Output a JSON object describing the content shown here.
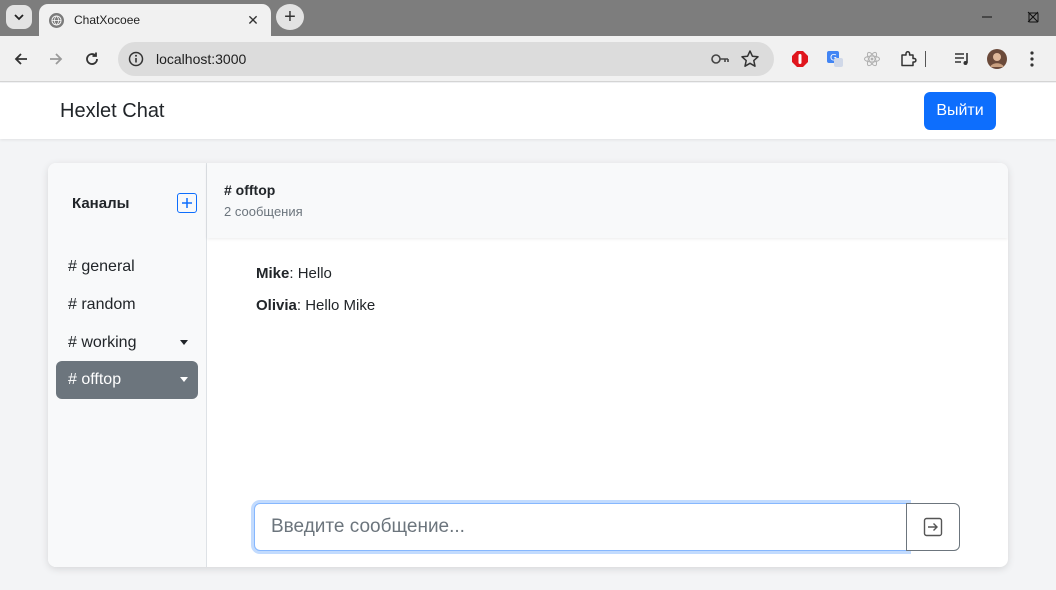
{
  "browser": {
    "tab_title": "ChatXocoee",
    "url": "localhost:3000"
  },
  "app": {
    "brand": "Hexlet Chat",
    "logout_label": "Выйти"
  },
  "sidebar": {
    "title": "Каналы",
    "channels": [
      {
        "label": "# general",
        "removable": false,
        "active": false
      },
      {
        "label": "# random",
        "removable": false,
        "active": false
      },
      {
        "label": "# working",
        "removable": true,
        "active": false
      },
      {
        "label": "# offtop",
        "removable": true,
        "active": true
      }
    ]
  },
  "chat": {
    "channel_name": "# offtop",
    "message_count": "2 сообщения",
    "messages": [
      {
        "author": "Mike",
        "text": ": Hello"
      },
      {
        "author": "Olivia",
        "text": ": Hello Mike"
      }
    ],
    "input_placeholder": "Введите сообщение..."
  },
  "colors": {
    "primary": "#0d6efd",
    "active_channel": "#6c757d"
  }
}
